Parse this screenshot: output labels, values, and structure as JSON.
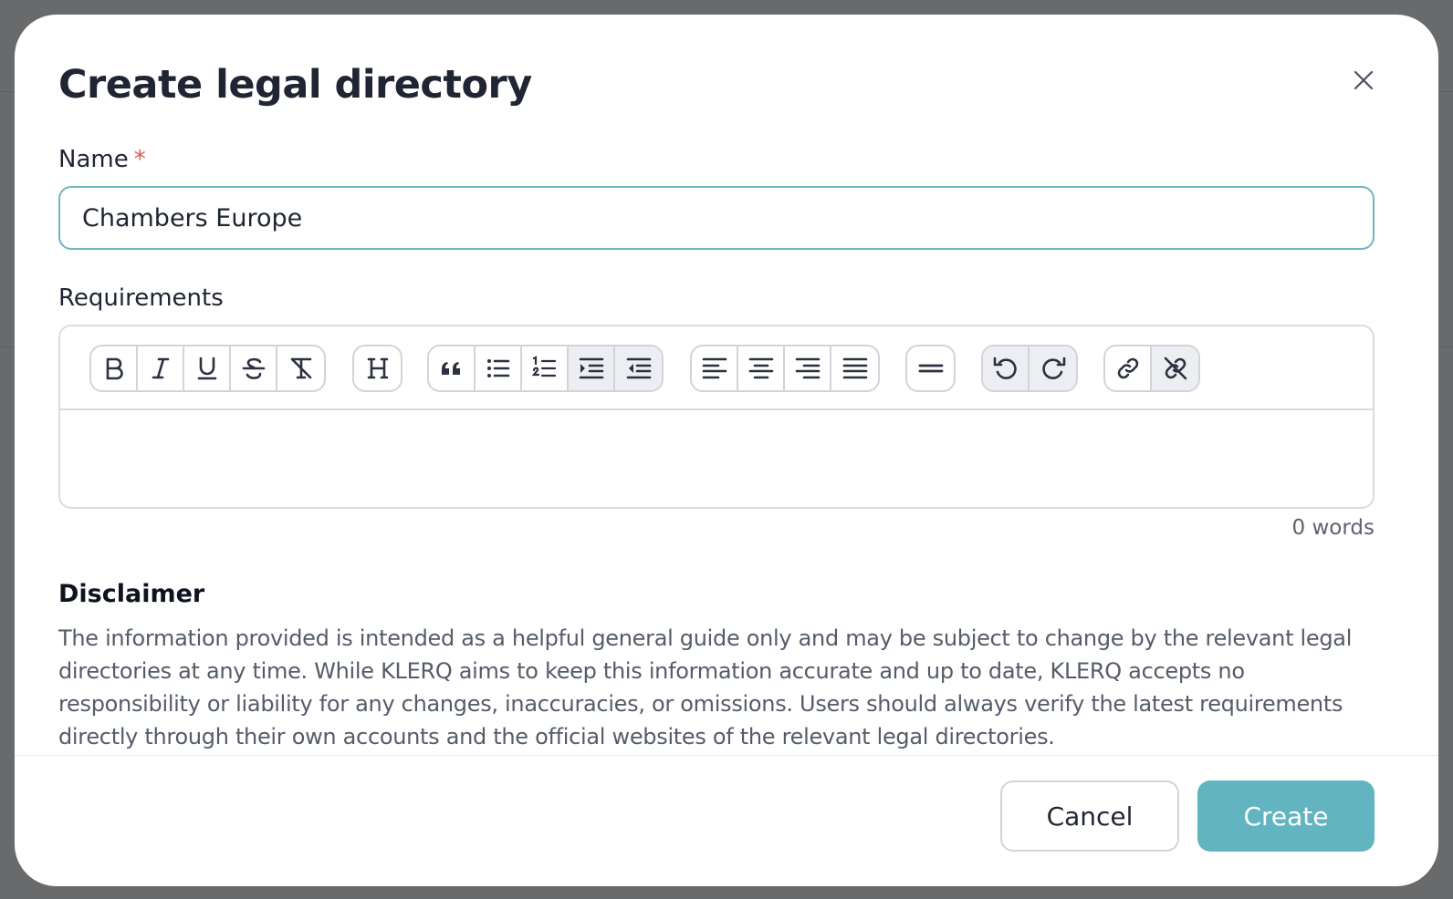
{
  "dialog": {
    "title": "Create legal directory"
  },
  "name_field": {
    "label": "Name",
    "required_marker": "*",
    "value": "Chambers Europe"
  },
  "requirements_field": {
    "label": "Requirements",
    "word_count": "0 words",
    "toolbar": {
      "groups": [
        [
          "bold-icon",
          "italic-icon",
          "underline-icon",
          "strikethrough-icon",
          "clear-format-icon"
        ],
        [
          "heading-icon"
        ],
        [
          "blockquote-icon",
          "bullet-list-icon",
          "numbered-list-icon",
          "indent-icon",
          "outdent-icon"
        ],
        [
          "align-left-icon",
          "align-center-icon",
          "align-right-icon",
          "align-justify-icon"
        ],
        [
          "horizontal-rule-icon"
        ],
        [
          "undo-icon",
          "redo-icon"
        ],
        [
          "link-icon",
          "unlink-icon"
        ]
      ]
    }
  },
  "disclaimer": {
    "heading": "Disclaimer",
    "text": "The information provided is intended as a helpful general guide only and may be subject to change by the relevant legal directories at any time. While KLERQ aims to keep this information accurate and up to date, KLERQ accepts no responsibility or liability for any changes, inaccuracies, or omissions. Users should always verify the latest requirements directly through their own accounts and the official websites of the relevant legal directories."
  },
  "footer": {
    "cancel_label": "Cancel",
    "create_label": "Create"
  },
  "colors": {
    "accent": "#62b5c0",
    "input_focus_border": "#6fb6c1",
    "required": "#e0584f",
    "overlay": "#696a6c"
  }
}
